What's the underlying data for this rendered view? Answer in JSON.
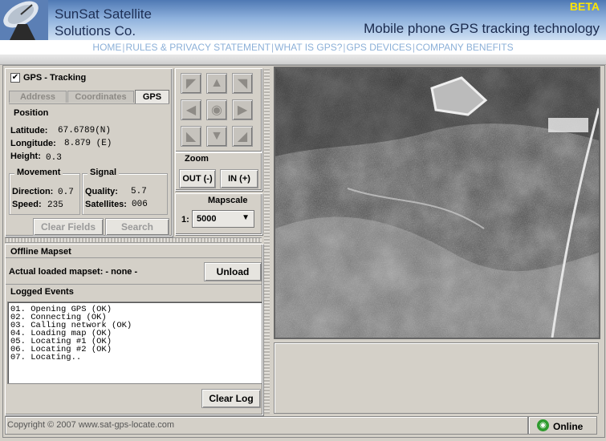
{
  "header": {
    "company_line1": "SunSat Satellite",
    "company_line2": "Solutions Co.",
    "beta": "BETA",
    "tagline": "Mobile phone GPS tracking technology"
  },
  "nav": [
    "HOME",
    "RULES & PRIVACY STATEMENT",
    "WHAT IS GPS?",
    "GPS DEVICES",
    "COMPANY BENEFITS"
  ],
  "tracking": {
    "checkbox_label": "GPS - Tracking",
    "checked": true,
    "tabs": [
      "Address",
      "Coordinates",
      "GPS"
    ],
    "active_tab": "GPS"
  },
  "position": {
    "title": "Position",
    "latitude_label": "Latitude:",
    "latitude_value": "67.6789(N)",
    "longitude_label": "Longitude:",
    "longitude_value": "8.879 (E)",
    "height_label": "Height:",
    "height_value": "0.3"
  },
  "movement": {
    "title": "Movement",
    "direction_label": "Direction:",
    "direction_value": "0.7",
    "speed_label": "Speed:",
    "speed_value": "235"
  },
  "signal": {
    "title": "Signal",
    "quality_label": "Quality:",
    "quality_value": "5.7",
    "satellites_label": "Satellites:",
    "satellites_value": "006"
  },
  "buttons": {
    "clear_fields": "Clear Fields",
    "search": "Search",
    "unload": "Unload",
    "clear_log": "Clear Log"
  },
  "zoom": {
    "title": "Zoom",
    "out": "OUT (-)",
    "in": "IN (+)"
  },
  "mapscale": {
    "title": "Mapscale",
    "prefix": "1:",
    "value": "5000"
  },
  "offline": {
    "title": "Offline Mapset",
    "actual_label": "Actual loaded mapset: - none -"
  },
  "log": {
    "title": "Logged Events",
    "lines": [
      "01. Opening GPS (OK)",
      "02. Connecting (OK)",
      "03. Calling network (OK)",
      "04. Loading map (OK)",
      "05. Locating #1 (OK)",
      "06. Locating #2 (OK)",
      "07. Locating.."
    ]
  },
  "footer": {
    "copyright": "Copyright © 2007 www.sat-gps-locate.com",
    "status": "Online"
  },
  "colors": {
    "header_gradient_top": "#4f79b4",
    "beta": "#ffe600",
    "nav_link": "#8cb0d8",
    "online_icon": "#2e9b2e"
  }
}
